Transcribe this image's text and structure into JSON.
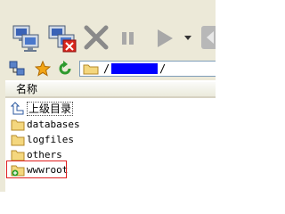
{
  "address": {
    "prefix": "/",
    "suffix": "/"
  },
  "list": {
    "column_name": "名称",
    "parent_label": "上级目录",
    "items": [
      {
        "name": "databases"
      },
      {
        "name": "logfiles"
      },
      {
        "name": "others"
      },
      {
        "name": "wwwroot"
      }
    ]
  },
  "colors": {
    "toolbar_bg": "#ece9d8",
    "redaction": "#0000ff",
    "highlight": "#e02020"
  },
  "icons": [
    "connect-icon",
    "disconnect-icon",
    "stop-icon",
    "pause-icon",
    "play-icon",
    "dropdown-arrow-icon",
    "network-icon",
    "bookmark-star-icon",
    "refresh-icon",
    "folder-icon",
    "parent-folder-icon",
    "folder-new-icon"
  ]
}
